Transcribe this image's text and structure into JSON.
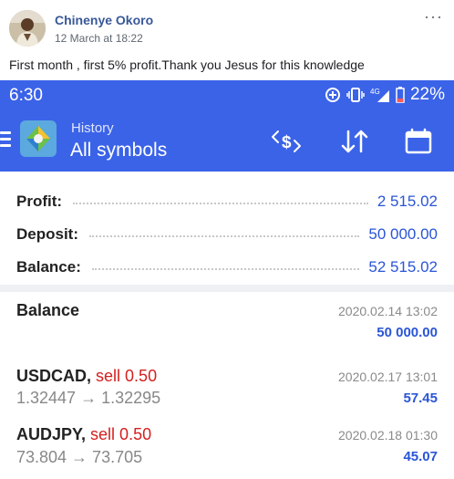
{
  "post": {
    "author": "Chinenye Okoro",
    "date": "12 March",
    "time_sep": "at",
    "time": "18:22",
    "more_label": "···",
    "text": "First month , first 5% profit.Thank you Jesus for this knowledge"
  },
  "status_bar": {
    "time": "6:30",
    "network": "4G",
    "battery": "22%"
  },
  "app_bar": {
    "subtitle": "History",
    "title": "All symbols",
    "icons": [
      "menu-icon",
      "currency-exchange-icon",
      "sort-icon",
      "calendar-icon"
    ]
  },
  "summary": {
    "profit_label": "Profit:",
    "profit_value": "2 515.02",
    "deposit_label": "Deposit:",
    "deposit_value": "50 000.00",
    "balance_label": "Balance:",
    "balance_value": "52 515.02"
  },
  "transactions": [
    {
      "name": "Balance",
      "date": "2020.02.14 13:02",
      "amount": "50 000.00"
    },
    {
      "symbol": "USDCAD,",
      "side": "sell 0.50",
      "prices": "1.32447 → 1.32295",
      "date": "2020.02.17 13:01",
      "amount": "57.45"
    },
    {
      "symbol": "AUDJPY,",
      "side": "sell 0.50",
      "prices": "73.804 → 73.705",
      "date": "2020.02.18 01:30",
      "amount": "45.07"
    }
  ],
  "colors": {
    "accent_blue": "#3b63e8",
    "value_blue": "#2a55d6",
    "sell_red": "#d42020",
    "link_blue": "#385898"
  }
}
